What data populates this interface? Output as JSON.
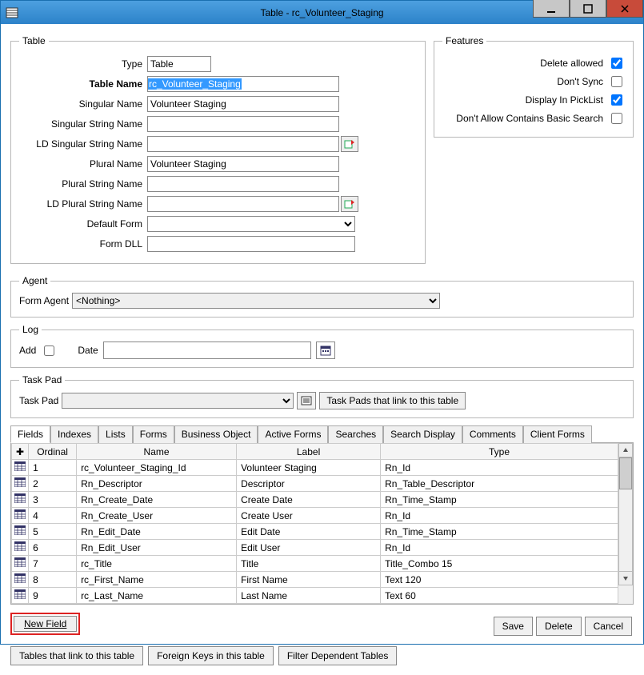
{
  "window": {
    "title": "Table - rc_Volunteer_Staging"
  },
  "table": {
    "legend": "Table",
    "type_label": "Type",
    "type_value": "Table",
    "name_label": "Table Name",
    "name_value": "rc_Volunteer_Staging",
    "singular_label": "Singular Name",
    "singular_value": "Volunteer Staging",
    "singular_string_label": "Singular String Name",
    "singular_string_value": "",
    "ld_singular_label": "LD Singular String Name",
    "ld_singular_value": "",
    "plural_label": "Plural Name",
    "plural_value": "Volunteer Staging",
    "plural_string_label": "Plural String Name",
    "plural_string_value": "",
    "ld_plural_label": "LD Plural String Name",
    "ld_plural_value": "",
    "default_form_label": "Default Form",
    "form_dll_label": "Form DLL",
    "form_dll_value": ""
  },
  "features": {
    "legend": "Features",
    "delete_allowed": "Delete allowed",
    "dont_sync": "Don't Sync",
    "display_picklist": "Display In PickList",
    "dont_allow_basic": "Don't Allow Contains Basic Search"
  },
  "agent": {
    "legend": "Agent",
    "form_agent_label": "Form Agent",
    "form_agent_value": "<Nothing>"
  },
  "log": {
    "legend": "Log",
    "add_label": "Add",
    "date_label": "Date"
  },
  "taskpad": {
    "legend": "Task Pad",
    "label": "Task Pad",
    "link_btn": "Task Pads that link to this table"
  },
  "tabs": [
    "Fields",
    "Indexes",
    "Lists",
    "Forms",
    "Business Object",
    "Active Forms",
    "Searches",
    "Search Display",
    "Comments",
    "Client Forms"
  ],
  "grid": {
    "headers": {
      "ordinal": "Ordinal",
      "name": "Name",
      "label": "Label",
      "type": "Type"
    },
    "rows": [
      {
        "ordinal": "1",
        "name": "rc_Volunteer_Staging_Id",
        "label": "Volunteer Staging",
        "type": "Rn_Id"
      },
      {
        "ordinal": "2",
        "name": "Rn_Descriptor",
        "label": "Descriptor",
        "type": "Rn_Table_Descriptor"
      },
      {
        "ordinal": "3",
        "name": "Rn_Create_Date",
        "label": "Create Date",
        "type": "Rn_Time_Stamp"
      },
      {
        "ordinal": "4",
        "name": "Rn_Create_User",
        "label": "Create User",
        "type": "Rn_Id"
      },
      {
        "ordinal": "5",
        "name": "Rn_Edit_Date",
        "label": "Edit Date",
        "type": "Rn_Time_Stamp"
      },
      {
        "ordinal": "6",
        "name": "Rn_Edit_User",
        "label": "Edit User",
        "type": "Rn_Id"
      },
      {
        "ordinal": "7",
        "name": "rc_Title",
        "label": "Title",
        "type": "Title_Combo 15"
      },
      {
        "ordinal": "8",
        "name": "rc_First_Name",
        "label": "First Name",
        "type": "Text 120"
      },
      {
        "ordinal": "9",
        "name": "rc_Last_Name",
        "label": "Last Name",
        "type": "Text 60"
      }
    ]
  },
  "buttons": {
    "new_field": "New Field",
    "tables_link": "Tables that link to this table",
    "foreign_keys": "Foreign Keys in this table",
    "filter_dependent": "Filter Dependent Tables",
    "save": "Save",
    "delete": "Delete",
    "cancel": "Cancel"
  }
}
